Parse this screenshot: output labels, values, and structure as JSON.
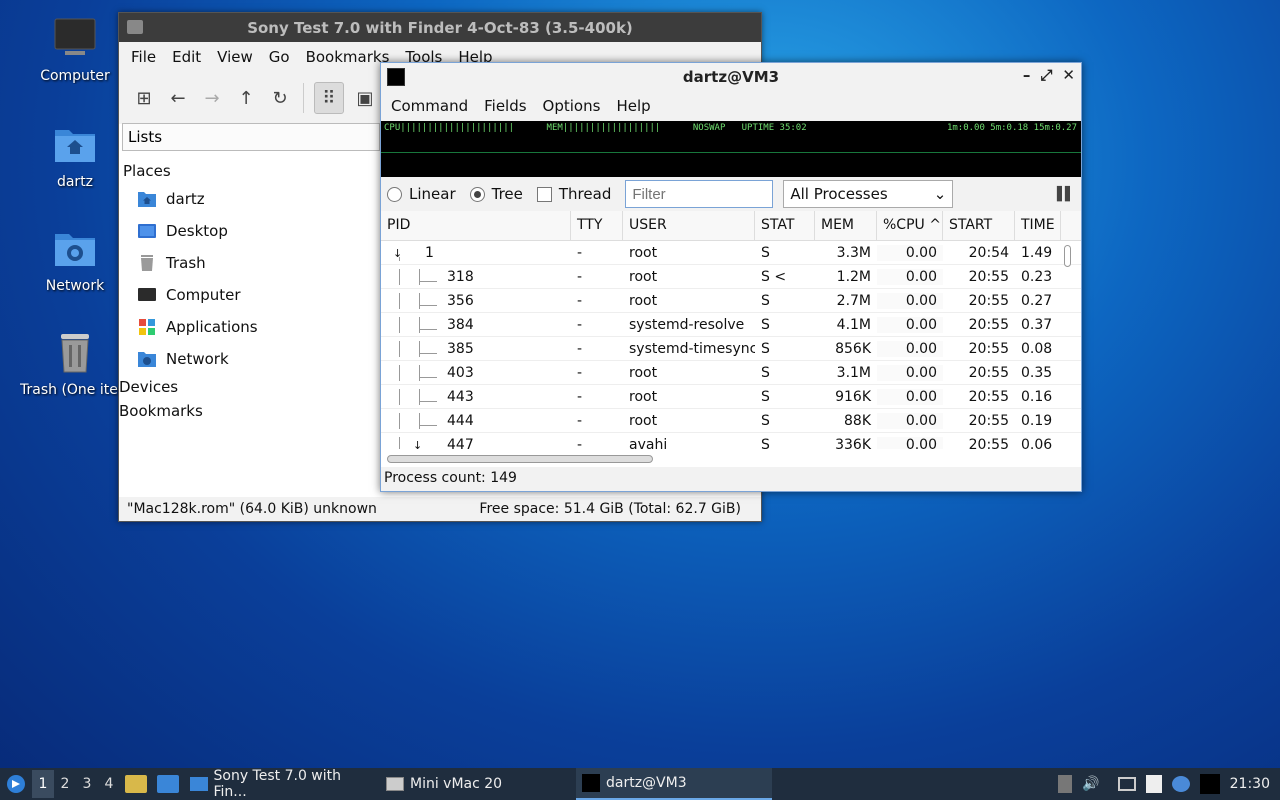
{
  "desktop": {
    "icons": [
      {
        "label": "Computer"
      },
      {
        "label": "dartz"
      },
      {
        "label": "Network"
      },
      {
        "label": "Trash (One item)"
      }
    ]
  },
  "file_manager": {
    "title": "Sony Test 7.0 with Finder 4-Oct-83 (3.5-400k)",
    "menu": [
      "File",
      "Edit",
      "View",
      "Go",
      "Bookmarks",
      "Tools",
      "Help"
    ],
    "path": "Lists",
    "places_header": "Places",
    "places": [
      {
        "label": "dartz",
        "icon": "home-folder-icon"
      },
      {
        "label": "Desktop",
        "icon": "desktop-icon"
      },
      {
        "label": "Trash",
        "icon": "trash-icon"
      },
      {
        "label": "Computer",
        "icon": "computer-icon"
      },
      {
        "label": "Applications",
        "icon": "applications-icon"
      },
      {
        "label": "Network",
        "icon": "network-icon"
      }
    ],
    "devices_header": "Devices",
    "bookmarks_header": "Bookmarks",
    "status_left": "\"Mac128k.rom\" (64.0 KiB) unknown",
    "status_right": "Free space: 51.4 GiB (Total: 62.7 GiB)"
  },
  "task_manager": {
    "title": "dartz@VM3",
    "menu": [
      "Command",
      "Fields",
      "Options",
      "Help"
    ],
    "graph_left": "CPU|||||||||||||||||||||      MEM||||||||||||||||||      NOSWAP   UPTIME 35:02",
    "graph_right": "1m:0.00 5m:0.18 15m:0.27",
    "modes": [
      {
        "label": "Linear",
        "checked": false
      },
      {
        "label": "Tree",
        "checked": true
      }
    ],
    "thread_label": "Thread",
    "filter_placeholder": "Filter",
    "process_select": "All Processes",
    "columns": [
      "PID",
      "TTY",
      "USER",
      "STAT",
      "MEM",
      "%CPU",
      "START",
      "TIME"
    ],
    "rows": [
      {
        "pid": "1",
        "tty": "-",
        "user": "root",
        "stat": "S",
        "mem": "3.3M",
        "cpu": "0.00",
        "start": "20:54",
        "time": "1.49",
        "level": 0
      },
      {
        "pid": "318",
        "tty": "-",
        "user": "root",
        "stat": "S <",
        "mem": "1.2M",
        "cpu": "0.00",
        "start": "20:55",
        "time": "0.23",
        "level": 1
      },
      {
        "pid": "356",
        "tty": "-",
        "user": "root",
        "stat": "S",
        "mem": "2.7M",
        "cpu": "0.00",
        "start": "20:55",
        "time": "0.27",
        "level": 1
      },
      {
        "pid": "384",
        "tty": "-",
        "user": "systemd-resolve",
        "stat": "S",
        "mem": "4.1M",
        "cpu": "0.00",
        "start": "20:55",
        "time": "0.37",
        "level": 1
      },
      {
        "pid": "385",
        "tty": "-",
        "user": "systemd-timesync",
        "stat": "S",
        "mem": "856K",
        "cpu": "0.00",
        "start": "20:55",
        "time": "0.08",
        "level": 1
      },
      {
        "pid": "403",
        "tty": "-",
        "user": "root",
        "stat": "S",
        "mem": "3.1M",
        "cpu": "0.00",
        "start": "20:55",
        "time": "0.35",
        "level": 1
      },
      {
        "pid": "443",
        "tty": "-",
        "user": "root",
        "stat": "S",
        "mem": "916K",
        "cpu": "0.00",
        "start": "20:55",
        "time": "0.16",
        "level": 1
      },
      {
        "pid": "444",
        "tty": "-",
        "user": "root",
        "stat": "S",
        "mem": "88K",
        "cpu": "0.00",
        "start": "20:55",
        "time": "0.19",
        "level": 1
      },
      {
        "pid": "447",
        "tty": "-",
        "user": "avahi",
        "stat": "S",
        "mem": "336K",
        "cpu": "0.00",
        "start": "20:55",
        "time": "0.06",
        "level": 1
      }
    ],
    "status": "Process count: 149"
  },
  "taskbar": {
    "workspaces": [
      "1",
      "2",
      "3",
      "4"
    ],
    "tasks": [
      {
        "label": "Sony Test 7.0 with Fin...",
        "active": false
      },
      {
        "label": "Mini vMac 20",
        "active": false
      },
      {
        "label": "dartz@VM3",
        "active": true
      }
    ],
    "clock": "21:30"
  }
}
